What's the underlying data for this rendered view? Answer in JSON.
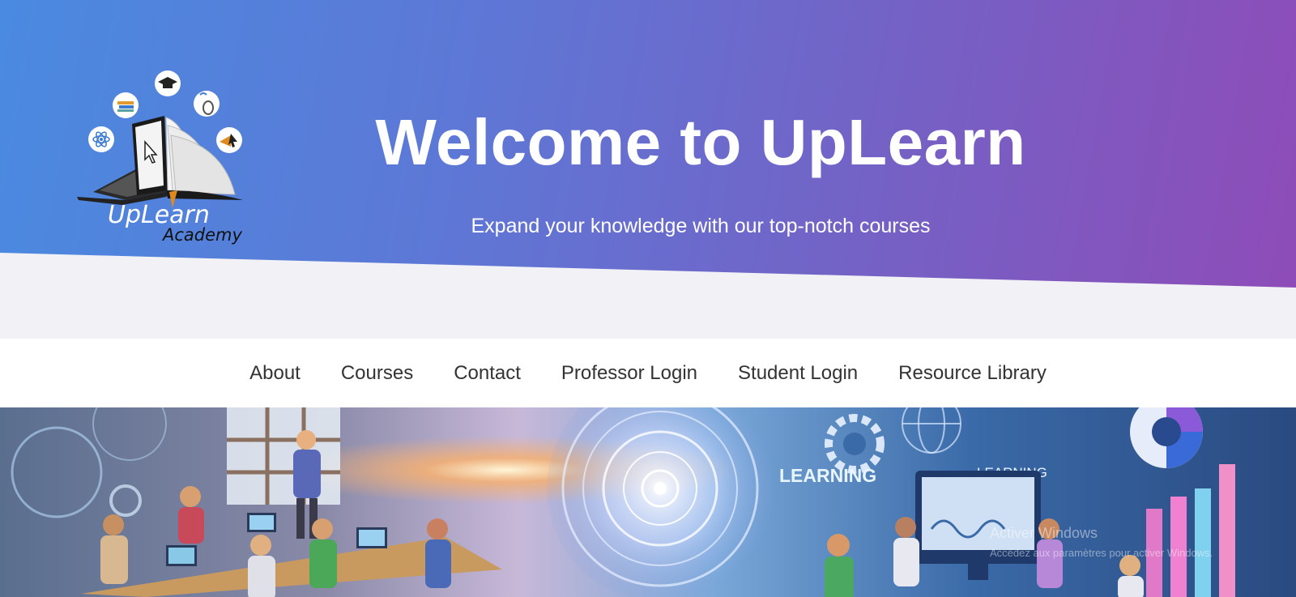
{
  "header": {
    "title": "Welcome to UpLearn",
    "subtitle": "Expand your knowledge with our top-notch courses",
    "gradient_start": "#4a8ae0",
    "gradient_end": "#8e4cb8"
  },
  "logo": {
    "brand": "UpLearn",
    "tagline": "Academy",
    "icons": [
      "graduation-cap-icon",
      "books-icon",
      "mouse-icon",
      "atom-icon",
      "cursor-arrow-icon",
      "laptop-icon",
      "open-book-icon"
    ]
  },
  "nav": {
    "items": [
      {
        "label": "About"
      },
      {
        "label": "Courses"
      },
      {
        "label": "Contact"
      },
      {
        "label": "Professor Login"
      },
      {
        "label": "Student Login"
      },
      {
        "label": "Resource Library"
      }
    ]
  },
  "banner": {
    "signs": [
      "LEARNING",
      "LEARNING"
    ],
    "watermark_title": "Activer Windows",
    "watermark_subtitle": "Accédez aux paramètres pour activer Windows."
  }
}
